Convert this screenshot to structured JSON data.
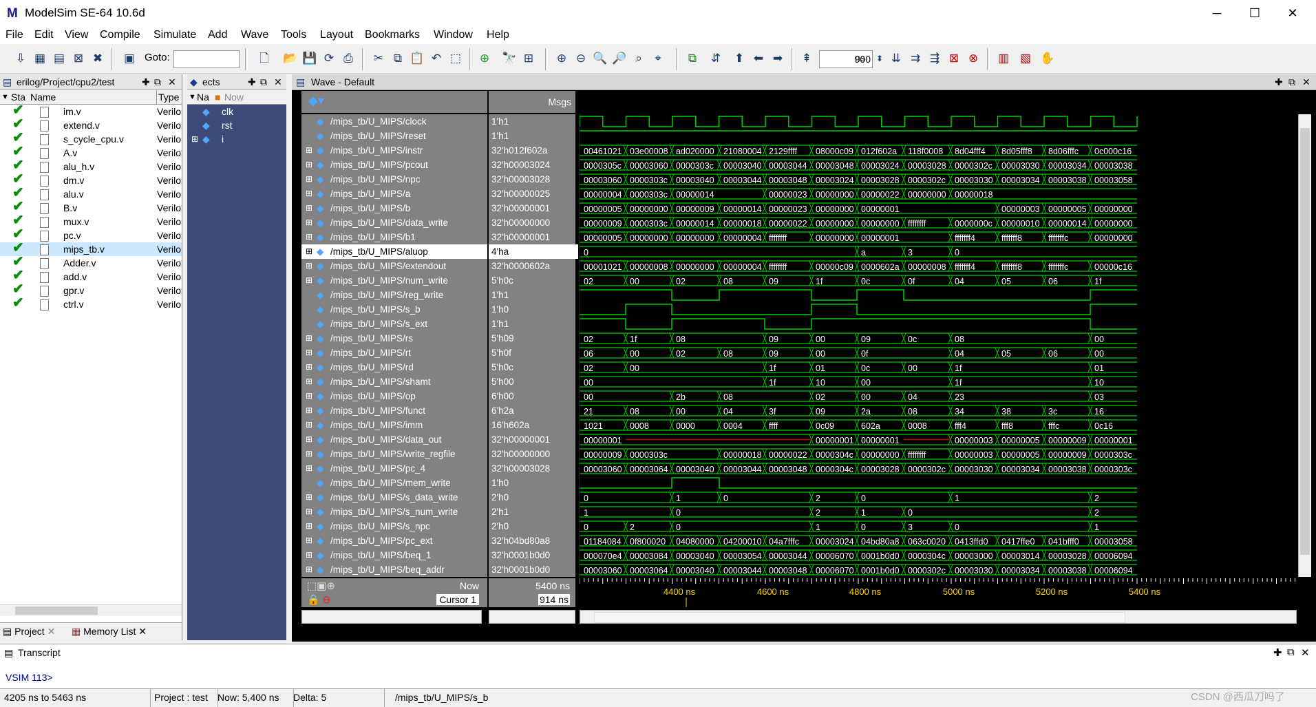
{
  "window": {
    "title": "ModelSim SE-64 10.6d",
    "minimize": "─",
    "maximize": "☐",
    "close": "✕"
  },
  "menu": [
    "File",
    "Edit",
    "View",
    "Compile",
    "Simulate",
    "Add",
    "Wave",
    "Tools",
    "Layout",
    "Bookmarks",
    "Window",
    "Help"
  ],
  "toolbar": {
    "goto_label": "Goto:",
    "goto_value": "",
    "runlength_value": "900",
    "runlength_unit": "ns"
  },
  "project": {
    "title": "erilog/Project/cpu2/test",
    "col_status": "Sta",
    "col_name": "Name",
    "col_type": "Type",
    "files": [
      {
        "name": "im.v",
        "type": "Verilo"
      },
      {
        "name": "extend.v",
        "type": "Verilo"
      },
      {
        "name": "s_cycle_cpu.v",
        "type": "Verilo"
      },
      {
        "name": "A.v",
        "type": "Verilo"
      },
      {
        "name": "alu_h.v",
        "type": "Verilo"
      },
      {
        "name": "dm.v",
        "type": "Verilo"
      },
      {
        "name": "alu.v",
        "type": "Verilo"
      },
      {
        "name": "B.v",
        "type": "Verilo"
      },
      {
        "name": "mux.v",
        "type": "Verilo"
      },
      {
        "name": "pc.v",
        "type": "Verilo"
      },
      {
        "name": "mips_tb.v",
        "type": "Verilo"
      },
      {
        "name": "Adder.v",
        "type": "Verilo"
      },
      {
        "name": "add.v",
        "type": "Verilo"
      },
      {
        "name": "gpr.v",
        "type": "Verilo"
      },
      {
        "name": "ctrl.v",
        "type": "Verilo"
      }
    ],
    "tabs": [
      "Project",
      "Memory List"
    ]
  },
  "objects": {
    "title": "ects",
    "col_name": "Na",
    "col_now": "Now",
    "items": [
      "clk",
      "rst",
      "i"
    ]
  },
  "wave": {
    "title": "Wave - Default",
    "msgs_header": "Msgs",
    "signals": [
      {
        "name": "/mips_tb/U_MIPS/clock",
        "value": "1'h1"
      },
      {
        "name": "/mips_tb/U_MIPS/reset",
        "value": "1'h1"
      },
      {
        "name": "/mips_tb/U_MIPS/instr",
        "value": "32'h012f602a"
      },
      {
        "name": "/mips_tb/U_MIPS/pcout",
        "value": "32'h00003024"
      },
      {
        "name": "/mips_tb/U_MIPS/npc",
        "value": "32'h00003028"
      },
      {
        "name": "/mips_tb/U_MIPS/a",
        "value": "32'h00000025"
      },
      {
        "name": "/mips_tb/U_MIPS/b",
        "value": "32'h00000001"
      },
      {
        "name": "/mips_tb/U_MIPS/data_write",
        "value": "32'h00000000"
      },
      {
        "name": "/mips_tb/U_MIPS/b1",
        "value": "32'h00000001"
      },
      {
        "name": "/mips_tb/U_MIPS/aluop",
        "value": "4'ha"
      },
      {
        "name": "/mips_tb/U_MIPS/extendout",
        "value": "32'h0000602a"
      },
      {
        "name": "/mips_tb/U_MIPS/num_write",
        "value": "5'h0c"
      },
      {
        "name": "/mips_tb/U_MIPS/reg_write",
        "value": "1'h1"
      },
      {
        "name": "/mips_tb/U_MIPS/s_b",
        "value": "1'h0"
      },
      {
        "name": "/mips_tb/U_MIPS/s_ext",
        "value": "1'h1"
      },
      {
        "name": "/mips_tb/U_MIPS/rs",
        "value": "5'h09"
      },
      {
        "name": "/mips_tb/U_MIPS/rt",
        "value": "5'h0f"
      },
      {
        "name": "/mips_tb/U_MIPS/rd",
        "value": "5'h0c"
      },
      {
        "name": "/mips_tb/U_MIPS/shamt",
        "value": "5'h00"
      },
      {
        "name": "/mips_tb/U_MIPS/op",
        "value": "6'h00"
      },
      {
        "name": "/mips_tb/U_MIPS/funct",
        "value": "6'h2a"
      },
      {
        "name": "/mips_tb/U_MIPS/imm",
        "value": "16'h602a"
      },
      {
        "name": "/mips_tb/U_MIPS/data_out",
        "value": "32'h00000001"
      },
      {
        "name": "/mips_tb/U_MIPS/write_regfile",
        "value": "32'h00000000"
      },
      {
        "name": "/mips_tb/U_MIPS/pc_4",
        "value": "32'h00003028"
      },
      {
        "name": "/mips_tb/U_MIPS/mem_write",
        "value": "1'h0"
      },
      {
        "name": "/mips_tb/U_MIPS/s_data_write",
        "value": "2'h0"
      },
      {
        "name": "/mips_tb/U_MIPS/s_num_write",
        "value": "2'h1"
      },
      {
        "name": "/mips_tb/U_MIPS/s_npc",
        "value": "2'h0"
      },
      {
        "name": "/mips_tb/U_MIPS/pc_ext",
        "value": "32'h04bd80a8"
      },
      {
        "name": "/mips_tb/U_MIPS/beq_1",
        "value": "32'h0001b0d0"
      },
      {
        "name": "/mips_tb/U_MIPS/beq_addr",
        "value": "32'h0001b0d0"
      }
    ],
    "bus_values": {
      "instr": [
        "00461021",
        "03e00008",
        "ad020000",
        "21080004",
        "2129ffff",
        "08000c09",
        "012f602a",
        "118f0008",
        "8d04fff4",
        "8d05fff8",
        "8d06fffc",
        "0c000c16"
      ],
      "pcout": [
        "0000305c",
        "00003060",
        "0000303c",
        "00003040",
        "00003044",
        "00003048",
        "00003024",
        "00003028",
        "0000302c",
        "00003030",
        "00003034",
        "00003038"
      ],
      "npc": [
        "00003060",
        "0000303c",
        "00003040",
        "00003044",
        "00003048",
        "00003024",
        "00003028",
        "0000302c",
        "00003030",
        "00003034",
        "00003038",
        "00003058"
      ],
      "a": [
        "00000004",
        "0000303c",
        "00000014",
        "",
        "00000023",
        "00000000",
        "00000022",
        "00000000",
        "00000018",
        "",
        "",
        ""
      ],
      "b": [
        "00000005",
        "00000000",
        "00000009",
        "00000014",
        "00000023",
        "00000000",
        "00000001",
        "",
        "",
        "00000003",
        "00000005",
        "00000000"
      ],
      "data_write": [
        "00000009",
        "0000303c",
        "00000014",
        "00000018",
        "00000022",
        "00000000",
        "00000000",
        "ffffffff",
        "0000000c",
        "00000010",
        "00000014",
        "00000000"
      ],
      "b1": [
        "00000005",
        "00000000",
        "00000000",
        "00000004",
        "ffffffff",
        "00000000",
        "00000001",
        "",
        "fffffff4",
        "fffffff8",
        "fffffffc",
        "00000000"
      ],
      "aluop": [
        "0",
        "",
        "",
        "",
        "",
        "",
        "a",
        "3",
        "0",
        "",
        "",
        ""
      ],
      "extendout": [
        "00001021",
        "00000008",
        "00000000",
        "00000004",
        "ffffffff",
        "00000c09",
        "0000602a",
        "00000008",
        "fffffff4",
        "fffffff8",
        "fffffffc",
        "00000c16"
      ],
      "num_write": [
        "02",
        "00",
        "02",
        "08",
        "09",
        "1f",
        "0c",
        "0f",
        "04",
        "05",
        "06",
        "1f"
      ],
      "rs": [
        "02",
        "1f",
        "08",
        "",
        "09",
        "00",
        "09",
        "0c",
        "08",
        "",
        "",
        "00"
      ],
      "rt": [
        "06",
        "00",
        "02",
        "08",
        "09",
        "00",
        "0f",
        "",
        "04",
        "05",
        "06",
        "00"
      ],
      "rd": [
        "02",
        "00",
        "",
        "",
        "1f",
        "01",
        "0c",
        "00",
        "1f",
        "",
        "",
        "01"
      ],
      "shamt": [
        "00",
        "",
        "",
        "",
        "1f",
        "10",
        "00",
        "",
        "1f",
        "",
        "",
        "10"
      ],
      "op": [
        "00",
        "",
        "2b",
        "08",
        "",
        "02",
        "00",
        "04",
        "23",
        "",
        "",
        "03"
      ],
      "funct": [
        "21",
        "08",
        "00",
        "04",
        "3f",
        "09",
        "2a",
        "08",
        "34",
        "38",
        "3c",
        "16"
      ],
      "imm": [
        "1021",
        "0008",
        "0000",
        "0004",
        "ffff",
        "0c09",
        "602a",
        "0008",
        "fff4",
        "fff8",
        "fffc",
        "0c16"
      ],
      "data_out": [
        "00000001",
        "",
        "",
        "",
        "",
        "00000001",
        "00000001",
        "",
        "00000003",
        "00000005",
        "00000009",
        "00000001"
      ],
      "write_regfile": [
        "00000009",
        "0000303c",
        "",
        "00000018",
        "00000022",
        "0000304c",
        "00000000",
        "ffffffff",
        "00000003",
        "00000005",
        "00000009",
        "0000303c"
      ],
      "pc_4": [
        "00003060",
        "00003064",
        "00003040",
        "00003044",
        "00003048",
        "0000304c",
        "00003028",
        "0000302c",
        "00003030",
        "00003034",
        "00003038",
        "0000303c"
      ],
      "s_data_write": [
        "0",
        "",
        "1",
        "0",
        "",
        "2",
        "0",
        "",
        "1",
        "",
        "",
        "2"
      ],
      "s_num_write": [
        "1",
        "",
        "0",
        "",
        "",
        "2",
        "1",
        "0",
        "",
        "",
        "",
        "2"
      ],
      "s_npc": [
        "0",
        "2",
        "0",
        "",
        "",
        "1",
        "0",
        "3",
        "0",
        "",
        "",
        "1"
      ],
      "pc_ext": [
        "01184084",
        "0f800020",
        "04080000",
        "04200010",
        "04a7fffc",
        "00003024",
        "04bd80a8",
        "063c0020",
        "0413ffd0",
        "0417ffe0",
        "041bfff0",
        "00003058"
      ],
      "beq_1": [
        "000070e4",
        "00003084",
        "00003040",
        "00003054",
        "00003044",
        "00006070",
        "0001b0d0",
        "0000304c",
        "00003000",
        "00003014",
        "00003028",
        "00006094"
      ],
      "beq_addr": [
        "00003060",
        "00003064",
        "00003040",
        "00003044",
        "00003048",
        "00006070",
        "0001b0d0",
        "0000302c",
        "00003030",
        "00003034",
        "00003038",
        "00006094"
      ]
    },
    "now_label": "Now",
    "now_value": "5400 ns",
    "cursor_label": "Cursor 1",
    "cursor_value": "914 ns",
    "ticks": [
      "4400 ns",
      "4600 ns",
      "4800 ns",
      "5000 ns",
      "5200 ns",
      "5400 ns"
    ],
    "colors": {
      "trace": "#00d000",
      "bus_fill": "#000",
      "red": "#d00000",
      "selected": "#ffffff"
    }
  },
  "transcript": {
    "title": "Transcript",
    "prompt": "VSIM 113>"
  },
  "statusbar": {
    "range": "4205 ns to 5463 ns",
    "project": "Project : test",
    "now": "Now: 5,400 ns",
    "delta": "Delta: 5",
    "path": "/mips_tb/U_MIPS/s_b",
    "watermark": "CSDN @西瓜刀吗了"
  }
}
